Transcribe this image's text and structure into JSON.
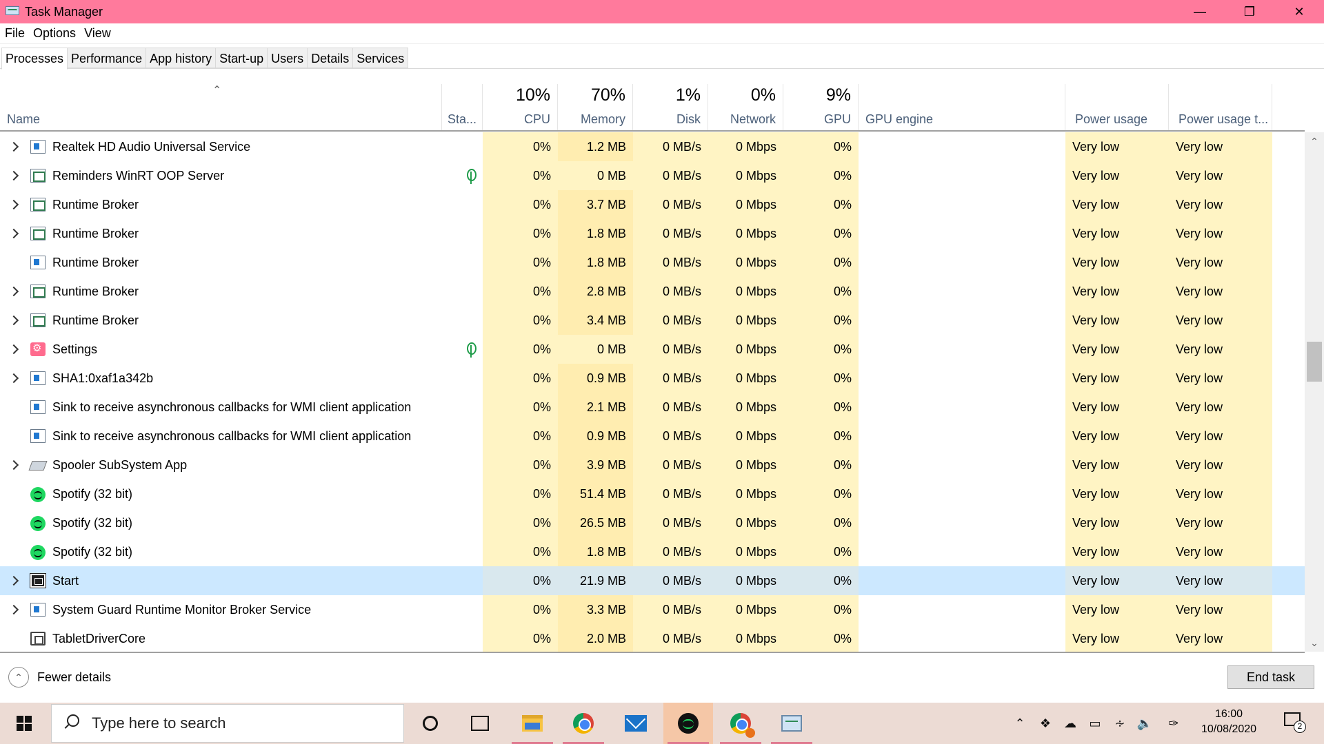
{
  "window": {
    "title": "Task Manager"
  },
  "menu": [
    "File",
    "Options",
    "View"
  ],
  "tabs": [
    {
      "label": "Processes",
      "active": true
    },
    {
      "label": "Performance"
    },
    {
      "label": "App history"
    },
    {
      "label": "Start-up"
    },
    {
      "label": "Users"
    },
    {
      "label": "Details"
    },
    {
      "label": "Services"
    }
  ],
  "columns": {
    "name": {
      "label": "Name"
    },
    "status": {
      "label": "Sta..."
    },
    "cpu": {
      "pct": "10%",
      "label": "CPU"
    },
    "memory": {
      "pct": "70%",
      "label": "Memory"
    },
    "disk": {
      "pct": "1%",
      "label": "Disk"
    },
    "network": {
      "pct": "0%",
      "label": "Network"
    },
    "gpu": {
      "pct": "9%",
      "label": "GPU"
    },
    "gpu_engine": {
      "label": "GPU engine"
    },
    "power": {
      "label": "Power usage"
    },
    "power_trend": {
      "label": "Power usage t..."
    }
  },
  "processes": [
    {
      "name": "Realtek HD Audio Universal Service",
      "icon": "service-icon",
      "expand": true,
      "suspended": false,
      "cpu": "0%",
      "memory": "1.2 MB",
      "disk": "0 MB/s",
      "network": "0 Mbps",
      "gpu": "0%",
      "gpu_engine": "",
      "power": "Very low",
      "power_trend": "Very low"
    },
    {
      "name": "Reminders WinRT OOP Server",
      "icon": "app-icon",
      "expand": true,
      "suspended": true,
      "cpu": "0%",
      "memory": "0 MB",
      "disk": "0 MB/s",
      "network": "0 Mbps",
      "gpu": "0%",
      "gpu_engine": "",
      "power": "Very low",
      "power_trend": "Very low"
    },
    {
      "name": "Runtime Broker",
      "icon": "app-icon",
      "expand": true,
      "suspended": false,
      "cpu": "0%",
      "memory": "3.7 MB",
      "disk": "0 MB/s",
      "network": "0 Mbps",
      "gpu": "0%",
      "gpu_engine": "",
      "power": "Very low",
      "power_trend": "Very low"
    },
    {
      "name": "Runtime Broker",
      "icon": "app-icon",
      "expand": true,
      "suspended": false,
      "cpu": "0%",
      "memory": "1.8 MB",
      "disk": "0 MB/s",
      "network": "0 Mbps",
      "gpu": "0%",
      "gpu_engine": "",
      "power": "Very low",
      "power_trend": "Very low"
    },
    {
      "name": "Runtime Broker",
      "icon": "service-icon",
      "expand": false,
      "suspended": false,
      "cpu": "0%",
      "memory": "1.8 MB",
      "disk": "0 MB/s",
      "network": "0 Mbps",
      "gpu": "0%",
      "gpu_engine": "",
      "power": "Very low",
      "power_trend": "Very low"
    },
    {
      "name": "Runtime Broker",
      "icon": "app-icon",
      "expand": true,
      "suspended": false,
      "cpu": "0%",
      "memory": "2.8 MB",
      "disk": "0 MB/s",
      "network": "0 Mbps",
      "gpu": "0%",
      "gpu_engine": "",
      "power": "Very low",
      "power_trend": "Very low"
    },
    {
      "name": "Runtime Broker",
      "icon": "app-icon",
      "expand": true,
      "suspended": false,
      "cpu": "0%",
      "memory": "3.4 MB",
      "disk": "0 MB/s",
      "network": "0 Mbps",
      "gpu": "0%",
      "gpu_engine": "",
      "power": "Very low",
      "power_trend": "Very low"
    },
    {
      "name": "Settings",
      "icon": "settings-icon",
      "expand": true,
      "suspended": true,
      "cpu": "0%",
      "memory": "0 MB",
      "disk": "0 MB/s",
      "network": "0 Mbps",
      "gpu": "0%",
      "gpu_engine": "",
      "power": "Very low",
      "power_trend": "Very low"
    },
    {
      "name": "SHA1:0xaf1a342b",
      "icon": "service-icon",
      "expand": true,
      "suspended": false,
      "cpu": "0%",
      "memory": "0.9 MB",
      "disk": "0 MB/s",
      "network": "0 Mbps",
      "gpu": "0%",
      "gpu_engine": "",
      "power": "Very low",
      "power_trend": "Very low"
    },
    {
      "name": "Sink to receive asynchronous callbacks for WMI client application",
      "icon": "service-icon",
      "expand": false,
      "suspended": false,
      "cpu": "0%",
      "memory": "2.1 MB",
      "disk": "0 MB/s",
      "network": "0 Mbps",
      "gpu": "0%",
      "gpu_engine": "",
      "power": "Very low",
      "power_trend": "Very low"
    },
    {
      "name": "Sink to receive asynchronous callbacks for WMI client application",
      "icon": "service-icon",
      "expand": false,
      "suspended": false,
      "cpu": "0%",
      "memory": "0.9 MB",
      "disk": "0 MB/s",
      "network": "0 Mbps",
      "gpu": "0%",
      "gpu_engine": "",
      "power": "Very low",
      "power_trend": "Very low"
    },
    {
      "name": "Spooler SubSystem App",
      "icon": "printer-icon",
      "expand": true,
      "suspended": false,
      "cpu": "0%",
      "memory": "3.9 MB",
      "disk": "0 MB/s",
      "network": "0 Mbps",
      "gpu": "0%",
      "gpu_engine": "",
      "power": "Very low",
      "power_trend": "Very low"
    },
    {
      "name": "Spotify (32 bit)",
      "icon": "spotify-icon",
      "expand": false,
      "suspended": false,
      "cpu": "0%",
      "memory": "51.4 MB",
      "disk": "0 MB/s",
      "network": "0 Mbps",
      "gpu": "0%",
      "gpu_engine": "",
      "power": "Very low",
      "power_trend": "Very low"
    },
    {
      "name": "Spotify (32 bit)",
      "icon": "spotify-icon",
      "expand": false,
      "suspended": false,
      "cpu": "0%",
      "memory": "26.5 MB",
      "disk": "0 MB/s",
      "network": "0 Mbps",
      "gpu": "0%",
      "gpu_engine": "",
      "power": "Very low",
      "power_trend": "Very low"
    },
    {
      "name": "Spotify (32 bit)",
      "icon": "spotify-icon",
      "expand": false,
      "suspended": false,
      "cpu": "0%",
      "memory": "1.8 MB",
      "disk": "0 MB/s",
      "network": "0 Mbps",
      "gpu": "0%",
      "gpu_engine": "",
      "power": "Very low",
      "power_trend": "Very low"
    },
    {
      "name": "Start",
      "icon": "start-icon",
      "expand": true,
      "suspended": false,
      "selected": true,
      "cpu": "0%",
      "memory": "21.9 MB",
      "disk": "0 MB/s",
      "network": "0 Mbps",
      "gpu": "0%",
      "gpu_engine": "",
      "power": "Very low",
      "power_trend": "Very low"
    },
    {
      "name": "System Guard Runtime Monitor Broker Service",
      "icon": "service-icon",
      "expand": true,
      "suspended": false,
      "cpu": "0%",
      "memory": "3.3 MB",
      "disk": "0 MB/s",
      "network": "0 Mbps",
      "gpu": "0%",
      "gpu_engine": "",
      "power": "Very low",
      "power_trend": "Very low"
    },
    {
      "name": "TabletDriverCore",
      "icon": "tablet-icon",
      "expand": false,
      "suspended": false,
      "cpu": "0%",
      "memory": "2.0 MB",
      "disk": "0 MB/s",
      "network": "0 Mbps",
      "gpu": "0%",
      "gpu_engine": "",
      "power": "Very low",
      "power_trend": "Very low"
    }
  ],
  "footer": {
    "fewer_details": "Fewer details",
    "end_task": "End task"
  },
  "taskbar": {
    "search_placeholder": "Type here to search",
    "time": "16:00",
    "date": "10/08/2020",
    "notification_count": "2",
    "pinned": [
      "cortana-icon",
      "task-view-icon",
      "file-explorer-icon",
      "chrome-icon",
      "mail-icon",
      "spotify-icon",
      "chrome-profile-icon",
      "task-manager-icon"
    ],
    "tray": [
      "chevron-up-icon",
      "dropbox-icon",
      "onedrive-icon",
      "battery-icon",
      "wifi-icon",
      "volume-icon",
      "pen-icon"
    ]
  },
  "colors": {
    "titlebar": "#ff7a9c",
    "heat_light": "#fff4c4",
    "selected_row": "#cce8ff",
    "taskbar": "#ecdbd4"
  }
}
